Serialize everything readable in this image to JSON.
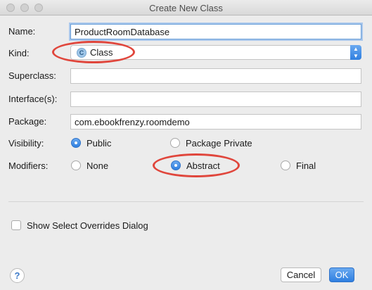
{
  "window": {
    "title": "Create New Class"
  },
  "form": {
    "name": {
      "label": "Name:",
      "value": "ProductRoomDatabase"
    },
    "kind": {
      "label": "Kind:",
      "value": "Class",
      "icon": "class-icon"
    },
    "superclass": {
      "label": "Superclass:",
      "value": ""
    },
    "interfaces": {
      "label": "Interface(s):",
      "value": ""
    },
    "package": {
      "label": "Package:",
      "value": "com.ebookfrenzy.roomdemo"
    },
    "visibility": {
      "label": "Visibility:",
      "options": [
        {
          "label": "Public",
          "checked": true
        },
        {
          "label": "Package Private",
          "checked": false
        }
      ]
    },
    "modifiers": {
      "label": "Modifiers:",
      "options": [
        {
          "label": "None",
          "checked": false
        },
        {
          "label": "Abstract",
          "checked": true
        },
        {
          "label": "Final",
          "checked": false
        }
      ]
    },
    "show_overrides": {
      "label": "Show Select Overrides Dialog",
      "checked": false
    }
  },
  "buttons": {
    "help": "?",
    "cancel": "Cancel",
    "ok": "OK"
  },
  "colors": {
    "accent": "#2f7fe0",
    "highlight": "#e0463c"
  }
}
